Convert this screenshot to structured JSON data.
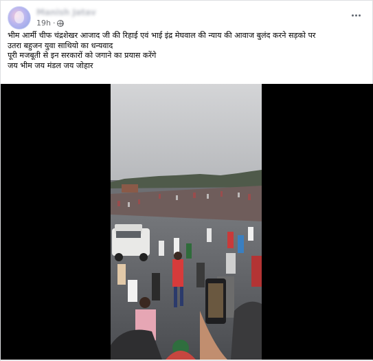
{
  "post": {
    "author": "Manish Jatav",
    "time": "19h",
    "separator": "·",
    "lines": [
      "भीम आर्मी चीफ चंद्रशेखर आजाद जी की रिहाई एवं भाई इंद्र मेघवाल की न्याय की आवाज बुलंद करने सड़को पर",
      "उतरा बहुजन युवा साथियो का धन्यवाद",
      "पूरी मजबूती से इन सरकारों को जगाने का प्रयास करेंगे",
      "जय भीम जय मंडल जय जोहार"
    ]
  },
  "icons": {
    "avatar": "profile-avatar",
    "privacy": "globe-icon",
    "menu": "more-options-icon"
  },
  "colors": {
    "meta_text": "#65676b",
    "video_letterbox": "#000000",
    "sky": "#c9cacc",
    "road": "#5a5c60"
  }
}
